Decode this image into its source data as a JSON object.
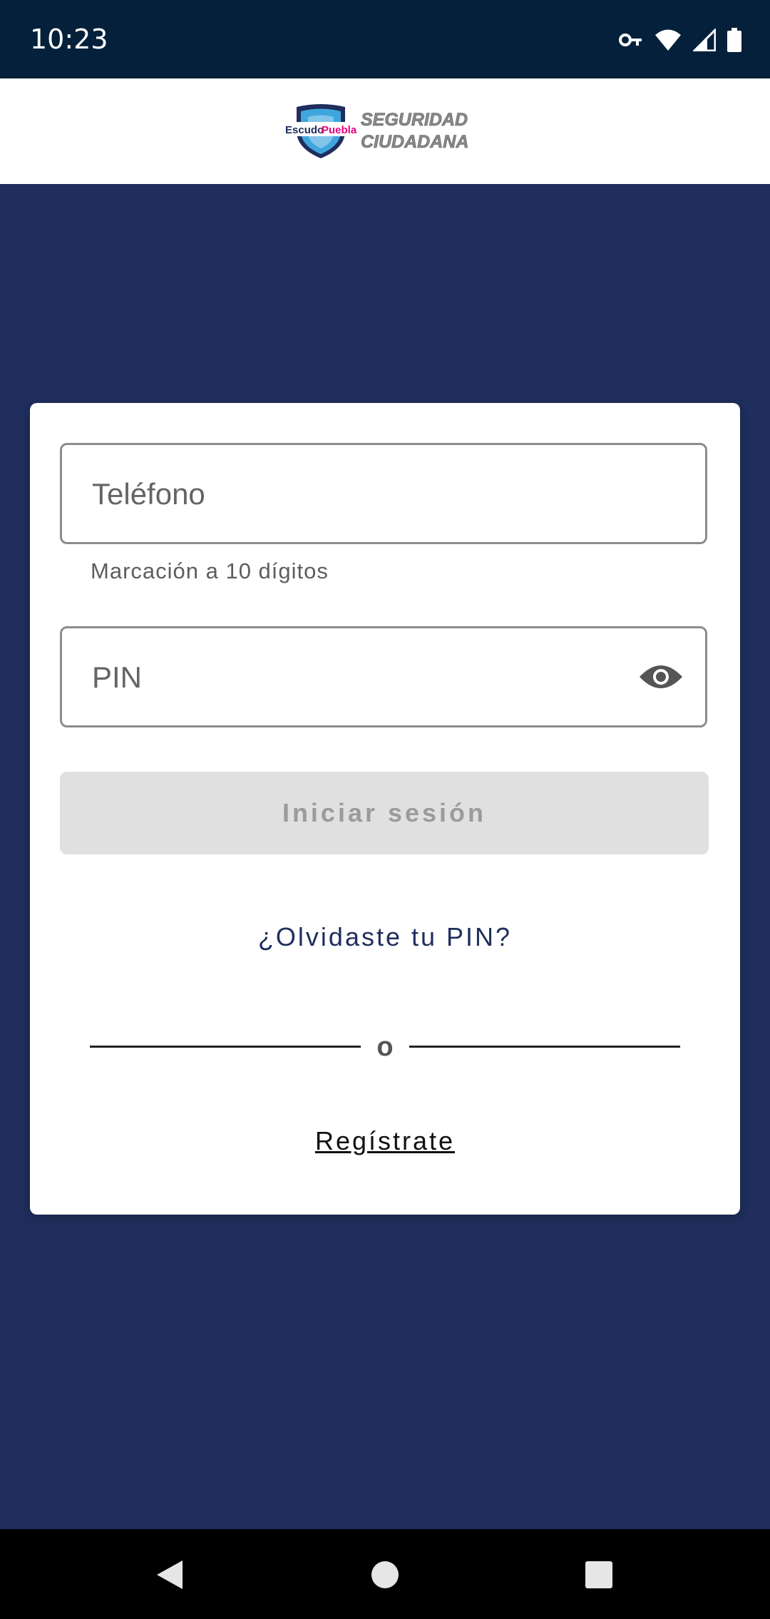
{
  "status_bar": {
    "time": "10:23",
    "icons": [
      "key-icon",
      "wifi-icon",
      "signal-icon",
      "battery-icon"
    ]
  },
  "header": {
    "logo": {
      "text_escudo": "Escudo",
      "text_puebla": "Puebla",
      "text_line1": "SEGURIDAD",
      "text_line2": "CIUDADANA"
    }
  },
  "login_form": {
    "phone": {
      "placeholder": "Teléfono",
      "value": "",
      "helper": "Marcación a 10 dígitos"
    },
    "pin": {
      "placeholder": "PIN",
      "value": "",
      "visibility_icon": "eye-icon"
    },
    "login_button": "Iniciar sesión",
    "forgot_pin": "¿Olvidaste tu PIN?",
    "divider_text": "o",
    "register": "Regístrate"
  },
  "colors": {
    "background": "#1f2e5c",
    "status_bar": "#04203a",
    "card": "#ffffff",
    "button_disabled": "#e0e0e0",
    "link": "#1f2e5c"
  },
  "nav_bar": {
    "buttons": [
      "back-icon",
      "home-icon",
      "recents-icon"
    ]
  }
}
